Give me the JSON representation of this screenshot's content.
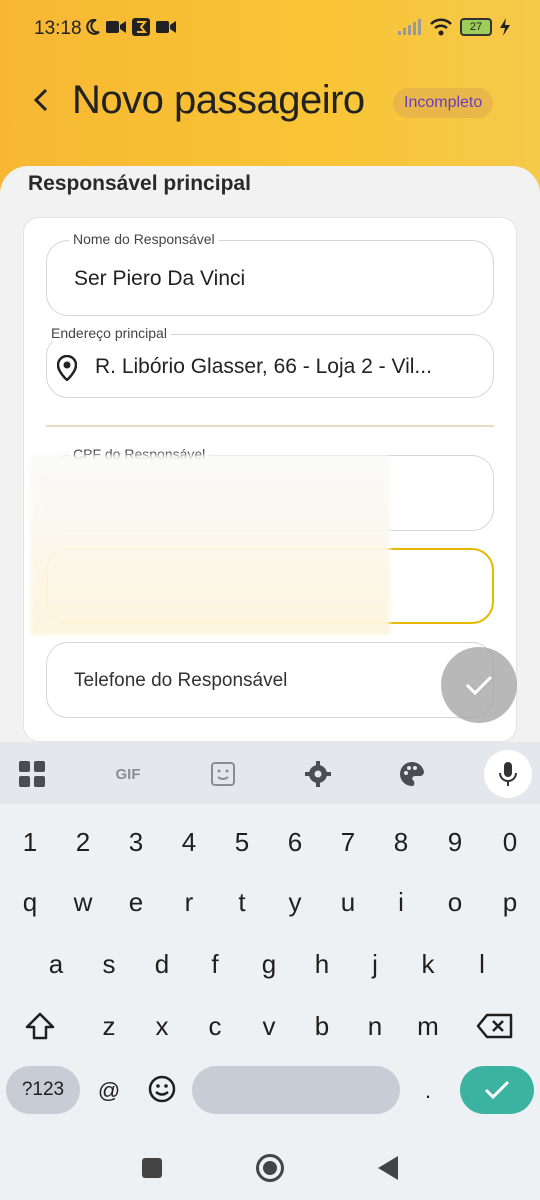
{
  "status_bar": {
    "time": "13:18",
    "battery": "27"
  },
  "header": {
    "back_icon": "arrow-back-icon",
    "title": "Novo passageiro",
    "badge": "Incompleto"
  },
  "section": {
    "title": "Responsável principal"
  },
  "form": {
    "nome_label": "Nome do Responsável",
    "nome_value": "Ser Piero Da Vinci",
    "endereco_label": "Endereço principal",
    "endereco_value": "R. Libório Glasser, 66 - Loja 2 - Vil...",
    "cpf_label": "CPF do Responsável",
    "telefone_placeholder": "Telefone do Responsável"
  },
  "keyboard": {
    "toolbar": [
      "apps-grid-icon",
      "GIF",
      "sticker-icon",
      "settings-icon",
      "palette-icon",
      "mic-icon"
    ],
    "gif_label": "GIF",
    "numbers": [
      "1",
      "2",
      "3",
      "4",
      "5",
      "6",
      "7",
      "8",
      "9",
      "0"
    ],
    "row1": [
      "q",
      "w",
      "e",
      "r",
      "t",
      "y",
      "u",
      "i",
      "o",
      "p"
    ],
    "row2": [
      "a",
      "s",
      "d",
      "f",
      "g",
      "h",
      "j",
      "k",
      "l"
    ],
    "row3": [
      "z",
      "x",
      "c",
      "v",
      "b",
      "n",
      "m"
    ],
    "symbols_label": "?123",
    "at_label": "@",
    "period_label": "."
  },
  "colors": {
    "header": "#f7b733",
    "badge_text": "#6b3fb8",
    "enter": "#3bb3a0",
    "focus": "#e6b800"
  }
}
